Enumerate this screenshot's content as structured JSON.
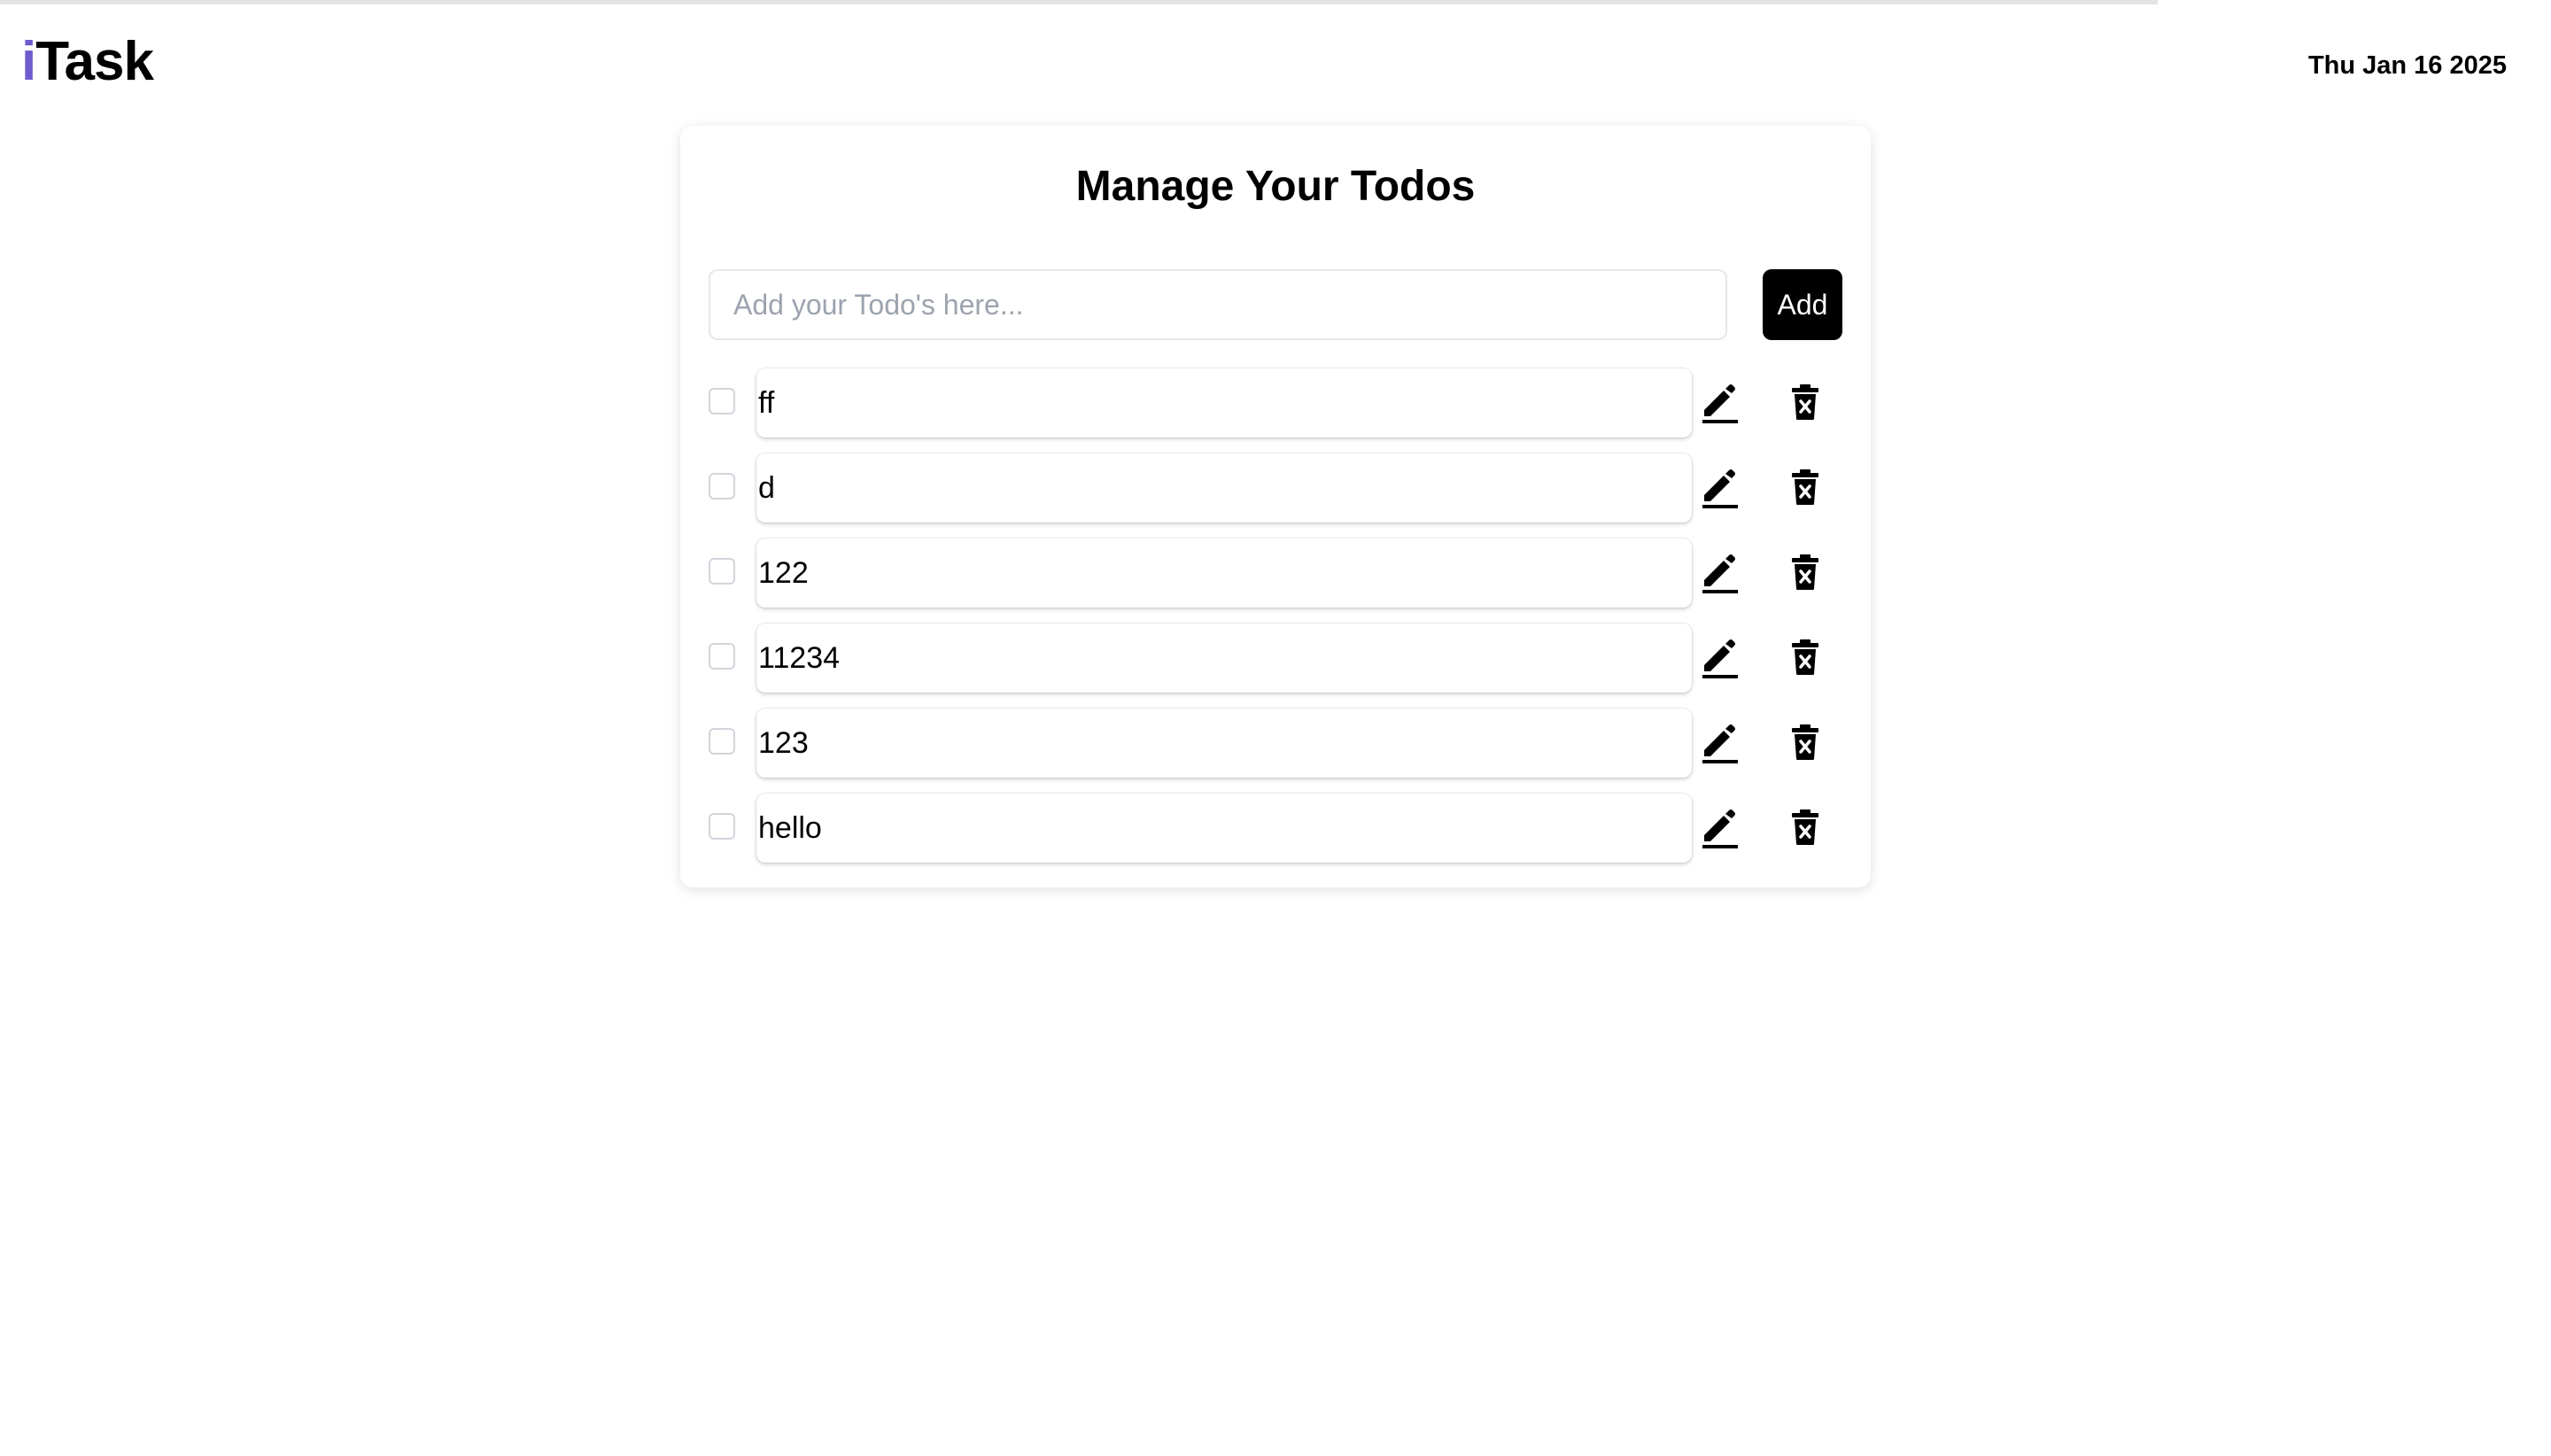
{
  "header": {
    "brand_prefix": "i",
    "brand_name": "Task",
    "date": "Thu Jan 16 2025"
  },
  "colors": {
    "brand_accent": "#6d5bd0",
    "button_bg": "#000000",
    "button_text": "#ffffff"
  },
  "main": {
    "title": "Manage Your Todos",
    "input": {
      "placeholder": "Add your Todo's here...",
      "value": ""
    },
    "add_label": "Add",
    "todos": [
      {
        "text": "ff",
        "done": false,
        "edit_icon": "pencil-icon",
        "delete_icon": "trash-icon"
      },
      {
        "text": "d",
        "done": false,
        "edit_icon": "pencil-icon",
        "delete_icon": "trash-icon"
      },
      {
        "text": "122",
        "done": false,
        "edit_icon": "pencil-icon",
        "delete_icon": "trash-icon"
      },
      {
        "text": "11234",
        "done": false,
        "edit_icon": "pencil-icon",
        "delete_icon": "trash-icon"
      },
      {
        "text": "123",
        "done": false,
        "edit_icon": "pencil-icon",
        "delete_icon": "trash-icon"
      },
      {
        "text": "hello",
        "done": false,
        "edit_icon": "pencil-icon",
        "delete_icon": "trash-icon"
      }
    ]
  }
}
